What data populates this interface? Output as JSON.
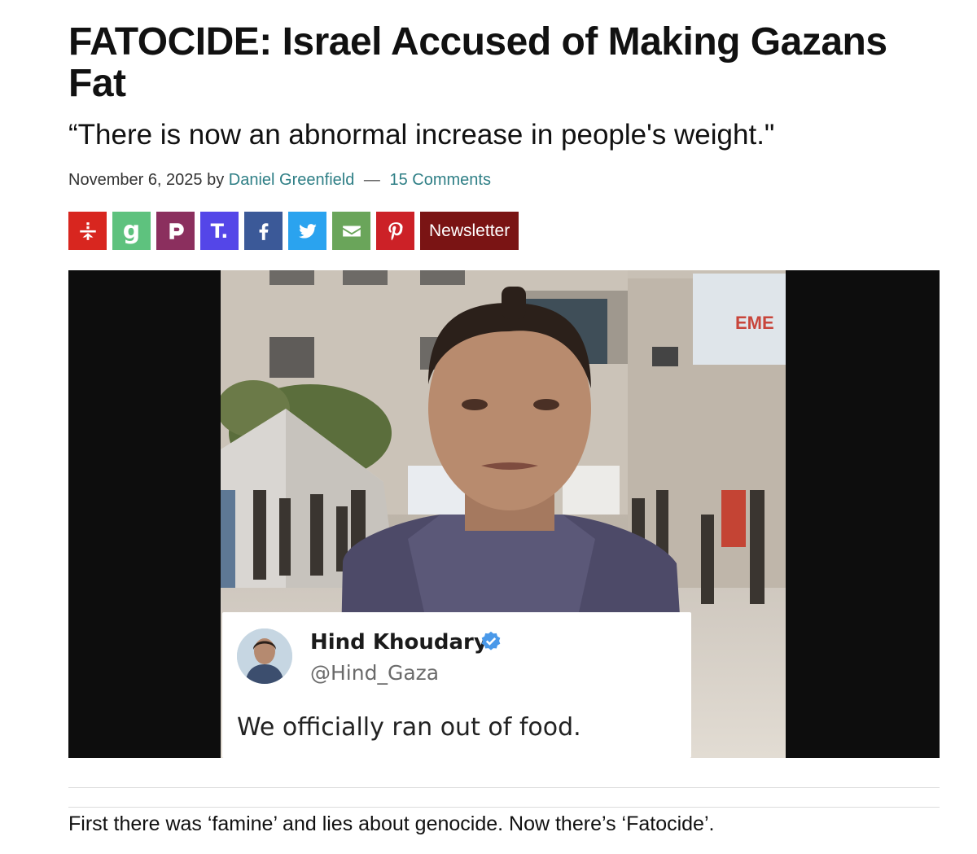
{
  "article": {
    "title": "FATOCIDE: Israel Accused of Making Gazans Fat",
    "subtitle": "“There is now an abnormal increase in people's weight.\"",
    "date": "November 6, 2025",
    "by": "by",
    "author": "Daniel Greenfield",
    "separator": "—",
    "comments": "15 Comments",
    "paragraph": "First there was ‘famine’ and lies about genocide. Now there’s ‘Fatocide’."
  },
  "share": {
    "buttons": [
      {
        "icon": "gettr-icon",
        "color": "#d8261f"
      },
      {
        "icon": "gab-icon",
        "label": "g",
        "color": "#5ec27e"
      },
      {
        "icon": "parler-icon",
        "color": "#8b2f5e"
      },
      {
        "icon": "truth-social-icon",
        "label": "T.",
        "color": "#5446e8"
      },
      {
        "icon": "facebook-icon",
        "color": "#3b5998"
      },
      {
        "icon": "twitter-icon",
        "color": "#2aa3ef"
      },
      {
        "icon": "email-icon",
        "color": "#6aa55a"
      },
      {
        "icon": "pinterest-icon",
        "color": "#cc2127"
      }
    ],
    "newsletter_label": "Newsletter",
    "newsletter_color": "#7a1414"
  },
  "video": {
    "sign_text": "EME",
    "tweet": {
      "name": "Hind Khoudary",
      "handle": "@Hind_Gaza",
      "text": "We officially ran out of food."
    }
  }
}
